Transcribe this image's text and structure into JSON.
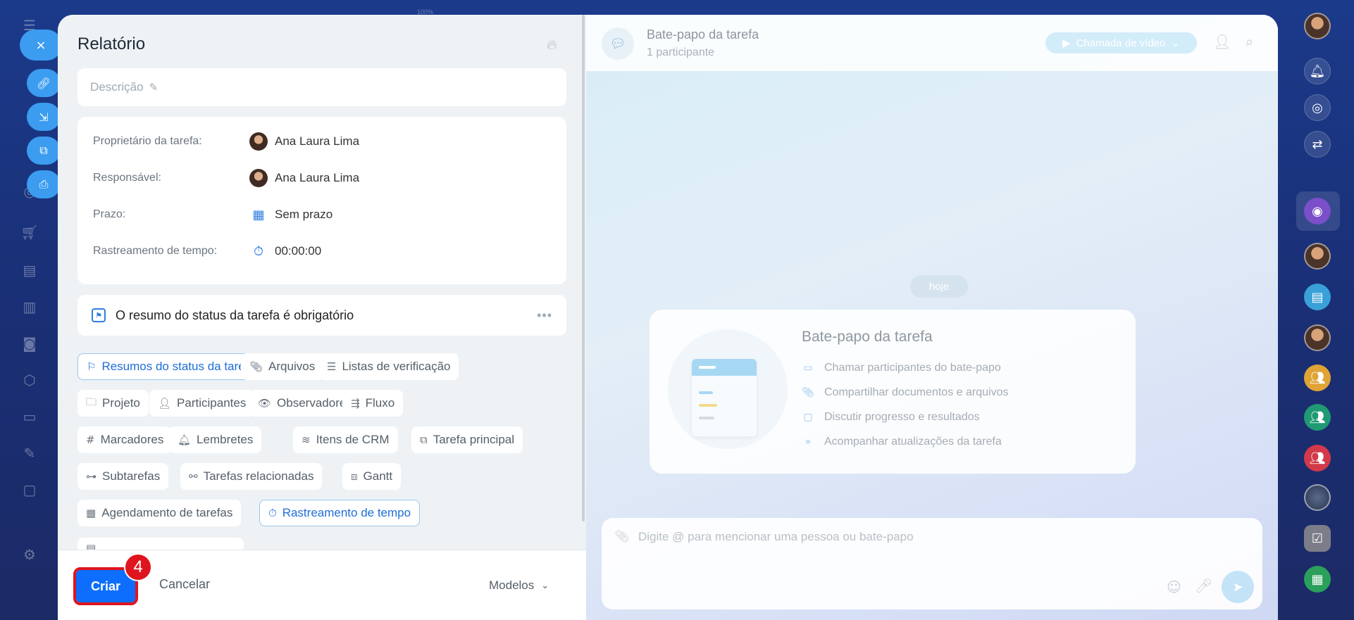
{
  "left_sidebar": {
    "close_label": "×",
    "float_icons": [
      "link-icon",
      "download-icon",
      "external-link-icon",
      "print-icon"
    ]
  },
  "background_window": {
    "zoom": "100%"
  },
  "form": {
    "title": "Relatório",
    "description_placeholder": "Descrição",
    "fields": [
      {
        "label": "Proprietário da tarefa:",
        "value": "Ana Laura Lima",
        "kind": "avatar"
      },
      {
        "label": "Responsável:",
        "value": "Ana Laura Lima",
        "kind": "avatar"
      },
      {
        "label": "Prazo:",
        "value": "Sem prazo",
        "kind": "calendar-icon"
      },
      {
        "label": "Rastreamento de tempo:",
        "value": "00:00:00",
        "kind": "timer-icon"
      }
    ],
    "status_summary": {
      "text": "O resumo do status da tarefa é obrigatório",
      "menu": "•••"
    },
    "chips": [
      {
        "label": "Resumos do status da tarefa",
        "icon": "status-icon",
        "active": true
      },
      {
        "label": "Arquivos",
        "icon": "paperclip-icon",
        "active": false
      },
      {
        "label": "Listas de verificação",
        "icon": "checklist-icon",
        "active": false
      },
      {
        "label": "Projeto",
        "icon": "folder-icon",
        "active": false
      },
      {
        "label": "Participantes",
        "icon": "person-icon",
        "active": false
      },
      {
        "label": "Observadores",
        "icon": "eye-icon",
        "active": false
      },
      {
        "label": "Fluxo",
        "icon": "flow-icon",
        "active": false
      },
      {
        "label": "Marcadores",
        "icon": "hash-icon",
        "active": false
      },
      {
        "label": "Lembretes",
        "icon": "bell-icon",
        "active": false
      },
      {
        "label": "Itens de CRM",
        "icon": "crm-icon",
        "active": false
      },
      {
        "label": "Tarefa principal",
        "icon": "parent-task-icon",
        "active": false
      },
      {
        "label": "Subtarefas",
        "icon": "subtask-icon",
        "active": false
      },
      {
        "label": "Tarefas relacionadas",
        "icon": "link-icon",
        "active": false
      },
      {
        "label": "Gantt",
        "icon": "gantt-icon",
        "active": false
      },
      {
        "label": "Agendamento de tarefas",
        "icon": "schedule-icon",
        "active": false
      },
      {
        "label": "Rastreamento de tempo",
        "icon": "timer-icon",
        "active": true
      }
    ]
  },
  "footer": {
    "create_label": "Criar",
    "badge": "4",
    "cancel_label": "Cancelar",
    "templates_label": "Modelos"
  },
  "chat": {
    "title": "Bate-papo da tarefa",
    "subtitle": "1 participante",
    "video_button": "Chamada de vídeo",
    "today": "hoje",
    "welcome": {
      "title": "Bate-papo da tarefa",
      "items": [
        {
          "text": "Chamar participantes do bate-papo",
          "icon": "video-icon"
        },
        {
          "text": "Compartilhar documentos e arquivos",
          "icon": "paperclip-icon"
        },
        {
          "text": "Discutir progresso e resultados",
          "icon": "chat-icon"
        },
        {
          "text": "Acompanhar atualizações da tarefa",
          "icon": "forward-icon"
        }
      ]
    },
    "composer_placeholder": "Digite @ para mencionar uma pessoa ou bate-papo"
  },
  "colors": {
    "primary": "#0d6efd",
    "highlight": "#e0141e",
    "accent": "#2f7de1"
  }
}
